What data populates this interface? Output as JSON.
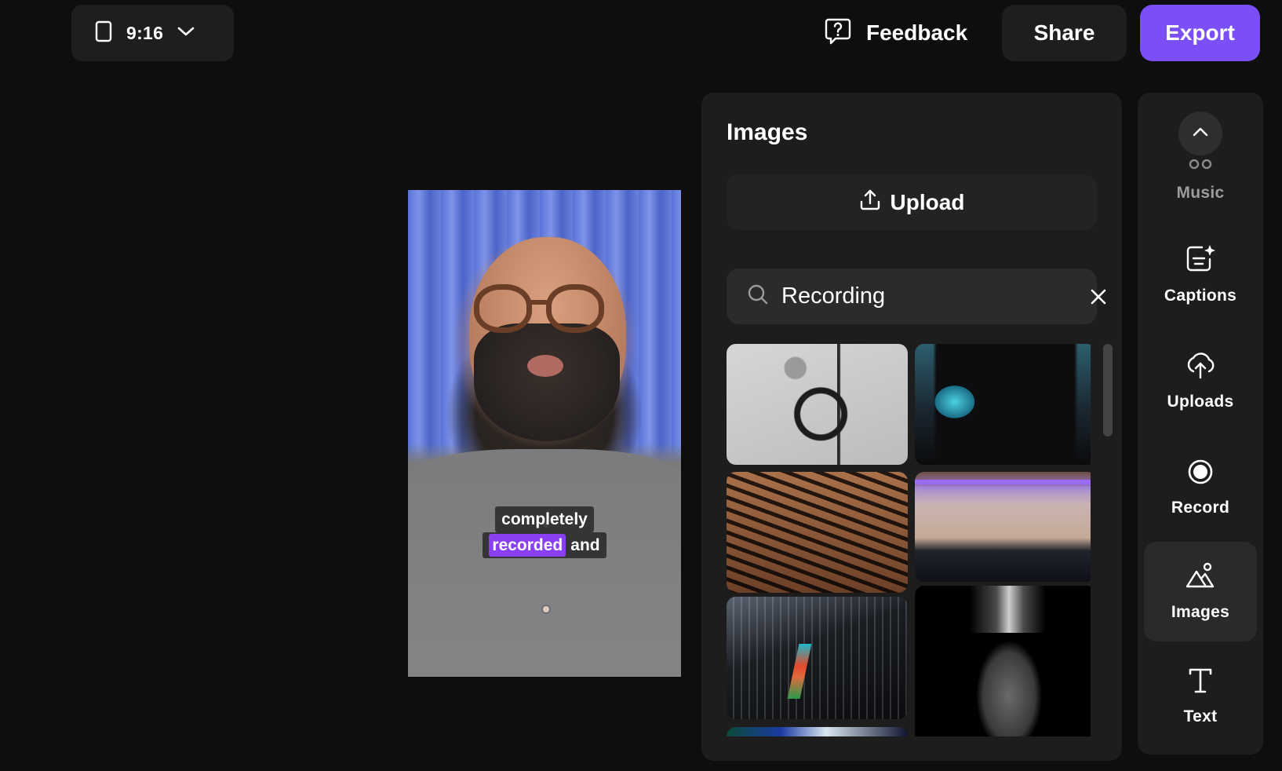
{
  "topbar": {
    "aspect_ratio": {
      "label": "9:16",
      "icon": "phone-portrait-icon"
    },
    "feedback": {
      "label": "Feedback",
      "icon": "feedback-question-icon"
    },
    "share_label": "Share",
    "export_label": "Export",
    "accent_color": "#7b4ff6"
  },
  "preview": {
    "caption": {
      "line1": [
        "completely"
      ],
      "line2_highlighted": "recorded",
      "line2_rest": "and",
      "highlight_color": "#8a3ff0"
    }
  },
  "images_panel": {
    "title": "Images",
    "upload_label": "Upload",
    "search": {
      "value": "Recording",
      "placeholder": "Search"
    },
    "results": [
      {
        "name": "microphone-with-headphones"
      },
      {
        "name": "video-camera-viewfinder"
      },
      {
        "name": "mixing-console-knobs"
      },
      {
        "name": "recording-studio-room"
      },
      {
        "name": "digital-mixer-board"
      },
      {
        "name": "condenser-microphone"
      },
      {
        "name": "partial-image"
      }
    ]
  },
  "rail": {
    "items": [
      {
        "label": "Music",
        "icon": "music-icon",
        "active": false
      },
      {
        "label": "Captions",
        "icon": "captions-icon",
        "active": false
      },
      {
        "label": "Uploads",
        "icon": "cloud-upload-icon",
        "active": false
      },
      {
        "label": "Record",
        "icon": "record-icon",
        "active": false
      },
      {
        "label": "Images",
        "icon": "images-icon",
        "active": true
      },
      {
        "label": "Text",
        "icon": "text-icon",
        "active": false
      }
    ]
  }
}
